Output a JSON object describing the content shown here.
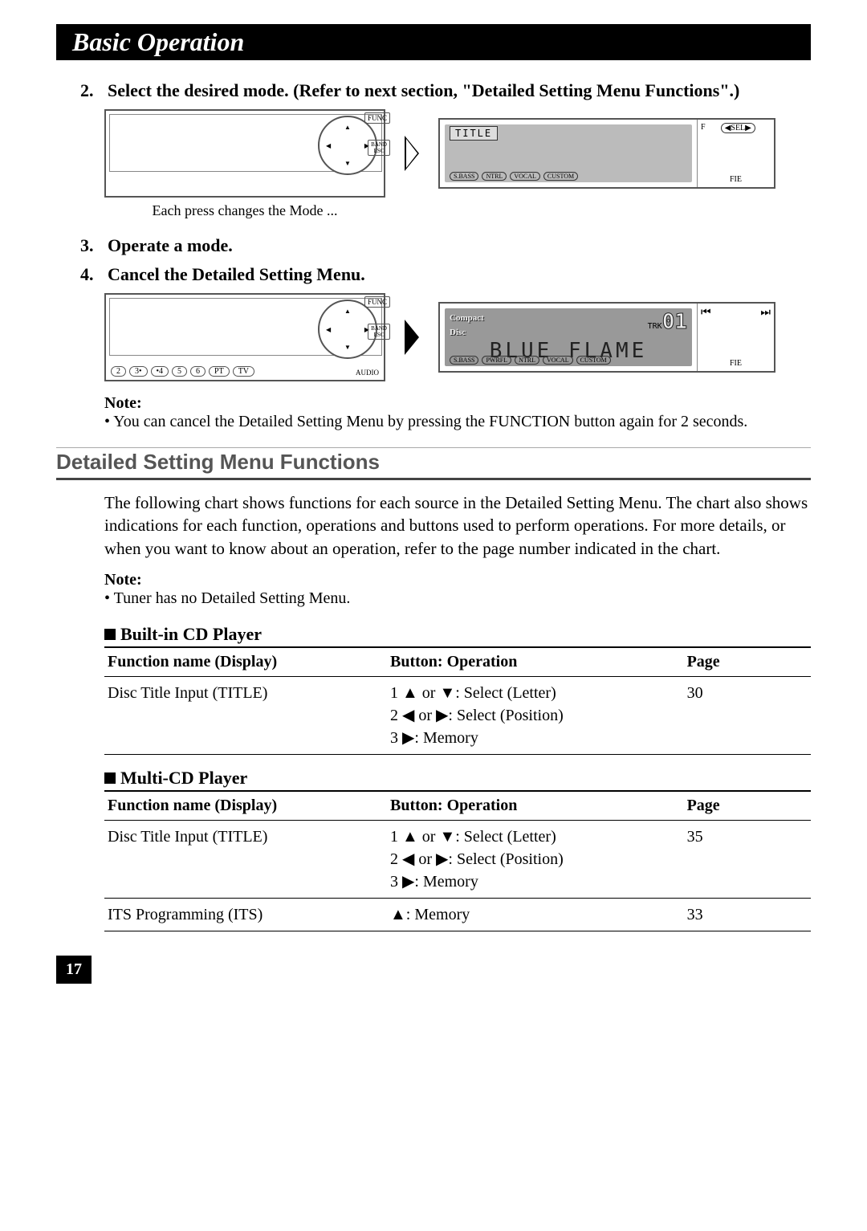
{
  "header": {
    "title": "Basic Operation"
  },
  "steps": {
    "s2": {
      "num": "2.",
      "text": "Select the desired mode. (Refer to next section, \"Detailed Setting Menu Functions\".)"
    },
    "s3": {
      "num": "3.",
      "text": "Operate a mode."
    },
    "s4": {
      "num": "4.",
      "text": "Cancel the Detailed Setting Menu."
    }
  },
  "caption1": "Each press changes the Mode ...",
  "device": {
    "func_label": "FUNC",
    "band_label": "BAND\nESC",
    "audio_label": "AUDIO",
    "buttons": [
      "2",
      "3•",
      "•4",
      "5",
      "6",
      "PT",
      "TV"
    ]
  },
  "lcd1": {
    "corner_title": "TITLE",
    "bottom_labels": [
      "S.BASS",
      "",
      "NTRL",
      "VOCAL",
      "CUSTOM"
    ],
    "side": {
      "f": "F",
      "sel": "SEL",
      "fie": "FIE"
    }
  },
  "lcd2": {
    "top_left": "Compact\nDisc",
    "trk": "TRK",
    "trk_num": "01",
    "big": "BLUE FLAME",
    "bottom_labels": [
      "S.BASS",
      "PWRFL",
      "NTRL",
      "VOCAL",
      "CUSTOM"
    ],
    "side": {
      "prev": "⏮",
      "next": "⏭",
      "fie": "FIE"
    }
  },
  "notes": {
    "label": "Note:",
    "n1": "You can cancel the Detailed Setting Menu by pressing the FUNCTION button again for 2 seconds.",
    "n2": "Tuner has no Detailed Setting Menu."
  },
  "section2": {
    "title": "Detailed Setting Menu Functions",
    "intro": "The following chart shows functions for each source in the Detailed Setting Menu. The chart also shows indications for each function, operations and buttons used to perform operations. For more details, or when you want to know about an operation, refer to the page number indicated in the chart."
  },
  "tables": {
    "headers": {
      "fn": "Function name (Display)",
      "op": "Button: Operation",
      "pg": "Page"
    },
    "cd": {
      "title": "Built-in CD Player",
      "rows": [
        {
          "fn": "Disc Title Input (TITLE)",
          "op": "1 ▲ or ▼: Select (Letter)\n2 ◀ or ▶: Select (Position)\n3 ▶: Memory",
          "pg": "30"
        }
      ]
    },
    "mcd": {
      "title": "Multi-CD Player",
      "rows": [
        {
          "fn": "Disc Title Input (TITLE)",
          "op": "1 ▲ or ▼: Select (Letter)\n2 ◀ or ▶: Select (Position)\n3 ▶: Memory",
          "pg": "35"
        },
        {
          "fn": "ITS Programming (ITS)",
          "op": "▲: Memory",
          "pg": "33"
        }
      ]
    }
  },
  "page_number": "17"
}
